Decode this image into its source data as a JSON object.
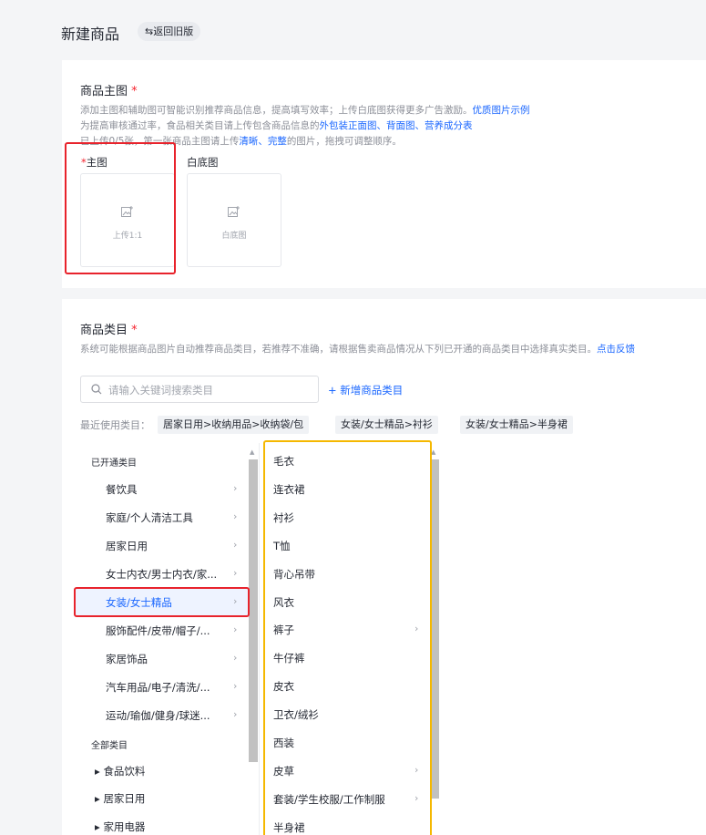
{
  "header": {
    "title": "新建商品",
    "back_button": "⇆返回旧版"
  },
  "main_image": {
    "title": "商品主图",
    "required_mark": "*",
    "hint1": "添加主图和辅助图可智能识别推荐商品信息，提高填写效率；上传白底图获得更多广告激励。",
    "hint1_link": "优质图片示例",
    "hint2_prefix": "为提高审核通过率，食品相关类目请上传包含商品信息的",
    "hint2_link": "外包装正面图、背面图、营养成分表",
    "hint3_prefix": "已上传0/5张，第一张商品主图请上传",
    "hint3_link": "清晰、完整",
    "hint3_suffix": "的图片，拖拽可调整顺序。",
    "slot_main_label": "主图",
    "slot_main_upload": "上传1:1",
    "slot_white_label": "白底图",
    "slot_white_upload": "白底图"
  },
  "category": {
    "title": "商品类目",
    "required_mark": "*",
    "hint": "系统可能根据商品图片自动推荐商品类目，若推荐不准确，请根据售卖商品情况从下列已开通的商品类目中选择真实类目。",
    "hint_link": "点击反馈",
    "search_placeholder": "请输入关键词搜索类目",
    "add_button": "+ 新增商品类目",
    "recent_label": "最近使用类目：",
    "recent": [
      "居家日用>收纳用品>收纳袋/包",
      "女装/女士精品>衬衫",
      "女装/女士精品>半身裙"
    ],
    "opened_header": "已开通类目",
    "opened_items": [
      "餐饮具",
      "家庭/个人清洁工具",
      "居家日用",
      "女士内衣/男士内衣/家...",
      "女装/女士精品",
      "服饰配件/皮带/帽子/...",
      "家居饰品",
      "汽车用品/电子/清洗/...",
      "运动/瑜伽/健身/球迷..."
    ],
    "selected_index": 4,
    "all_header": "全部类目",
    "all_items": [
      "食品饮料",
      "居家日用",
      "家用电器"
    ],
    "sub_items": [
      {
        "label": "毛衣",
        "has_children": false
      },
      {
        "label": "连衣裙",
        "has_children": false
      },
      {
        "label": "衬衫",
        "has_children": false
      },
      {
        "label": "T恤",
        "has_children": false
      },
      {
        "label": "背心吊带",
        "has_children": false
      },
      {
        "label": "风衣",
        "has_children": false
      },
      {
        "label": "裤子",
        "has_children": true
      },
      {
        "label": "牛仔裤",
        "has_children": false
      },
      {
        "label": "皮衣",
        "has_children": false
      },
      {
        "label": "卫衣/绒衫",
        "has_children": false
      },
      {
        "label": "西装",
        "has_children": false
      },
      {
        "label": "皮草",
        "has_children": true
      },
      {
        "label": "套装/学生校服/工作制服",
        "has_children": true
      },
      {
        "label": "半身裙",
        "has_children": false
      }
    ]
  },
  "colors": {
    "accent": "#1966ff",
    "required": "#f5222d",
    "highlight_red": "#e8232c",
    "highlight_orange": "#f5b800"
  }
}
